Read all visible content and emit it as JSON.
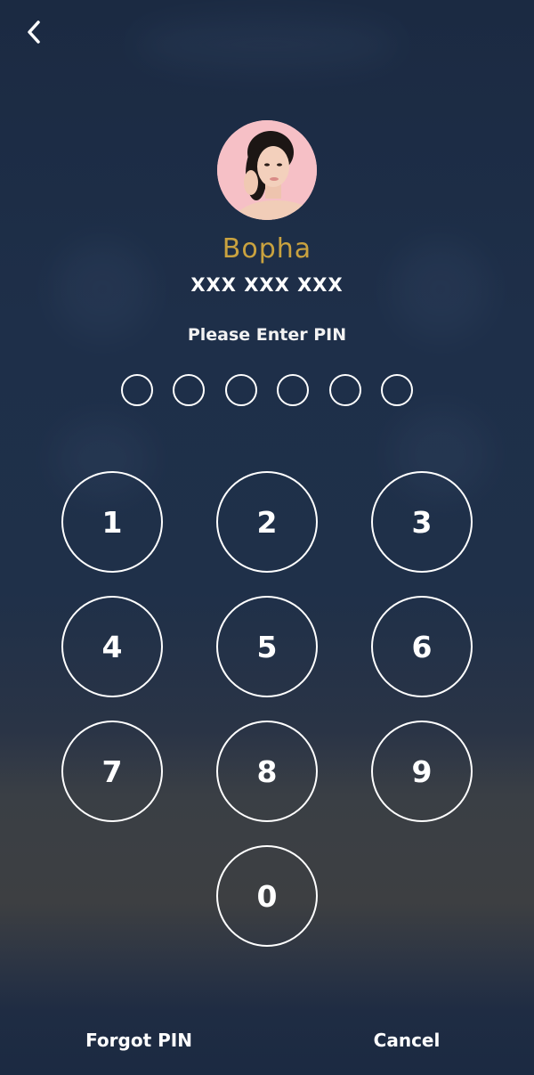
{
  "header": {
    "back_icon": "chevron-left-icon"
  },
  "user": {
    "name": "Bopha",
    "phone": "XXX XXX XXX",
    "avatar_bg": "#f6c0c6"
  },
  "pin": {
    "prompt": "Please Enter PIN",
    "length": 6,
    "entered": 0
  },
  "keypad": {
    "keys": [
      "1",
      "2",
      "3",
      "4",
      "5",
      "6",
      "7",
      "8",
      "9",
      "0"
    ]
  },
  "footer": {
    "forgot_label": "Forgot PIN",
    "cancel_label": "Cancel"
  },
  "colors": {
    "accent_name": "#c9a23f",
    "background": "#1e2f49"
  }
}
